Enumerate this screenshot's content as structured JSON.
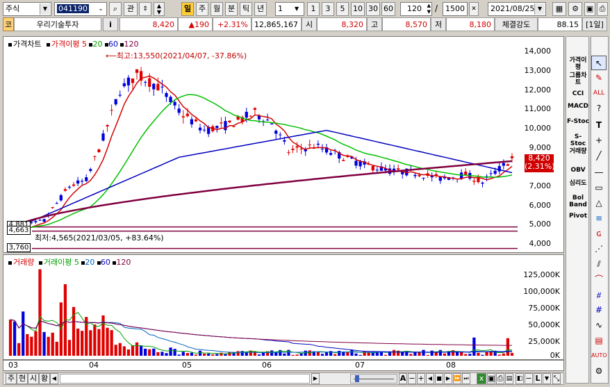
{
  "toolbar": {
    "market_select": "주식",
    "code": "041190",
    "btn_kwan": "관",
    "period_active": "일",
    "periods": [
      "주",
      "월",
      "분",
      "틱",
      "년"
    ],
    "interval_value": "1",
    "nums": [
      "1",
      "3",
      "5",
      "10",
      "30",
      "60"
    ],
    "count_value": "120",
    "slash": "/",
    "total_value": "1500",
    "date_value": "2021/08/25"
  },
  "quote": {
    "market_badge": "코",
    "name": "우리기술투자",
    "info_btn": "i",
    "price": "8,420",
    "change": "▲190",
    "change_pct": "+2.31%",
    "volume": "12,865,167",
    "open_label": "시",
    "open": "8,320",
    "high_label": "고",
    "high": "8,570",
    "low_label": "저",
    "low": "8,180",
    "strength_label": "체결강도",
    "strength": "88.15",
    "period_badge": "[1일]"
  },
  "price_legend": {
    "title": "가격차트",
    "ma_label": "가격이평",
    "ma": [
      "5",
      "20",
      "60",
      "120"
    ]
  },
  "annotations": {
    "high": "최고:13,550(2021/04/07, -37.86%)",
    "low": "최저:4,565(2021/03/05, +83.64%)"
  },
  "price_axis": [
    "14,000",
    "13,000",
    "12,000",
    "11,000",
    "10,000",
    "9,000",
    "8,000",
    "7,000",
    "6,000",
    "5,000",
    "4,000"
  ],
  "price_tags": {
    "current": "8,420",
    "current_pct": "(2.31%)",
    "level1": "4,881",
    "level2": "4,663",
    "level3": "3,760"
  },
  "volume_legend": {
    "title": "거래량",
    "ma_label": "거래이평",
    "ma": [
      "5",
      "20",
      "60",
      "120"
    ]
  },
  "volume_axis": [
    "125,000K",
    "100,000K",
    "75,000K",
    "50,000K",
    "25,000K",
    "0K"
  ],
  "x_axis": [
    "03",
    "04",
    "05",
    "06",
    "07",
    "08"
  ],
  "right_panel": [
    "가격이평",
    "그룹차트",
    "CCI",
    "MACD",
    "F-Stoc",
    "S-Stoc",
    "거래량",
    "OBV",
    "심리도",
    "Bol Band",
    "Pivot"
  ],
  "bottom_tabs": [
    "주",
    "현",
    "시",
    "황"
  ],
  "colors": {
    "up": "#e00000",
    "down": "#0000dd",
    "ma5": "#d40000",
    "ma20": "#00c000",
    "ma60": "#0000c0",
    "ma120": "#800040"
  }
}
